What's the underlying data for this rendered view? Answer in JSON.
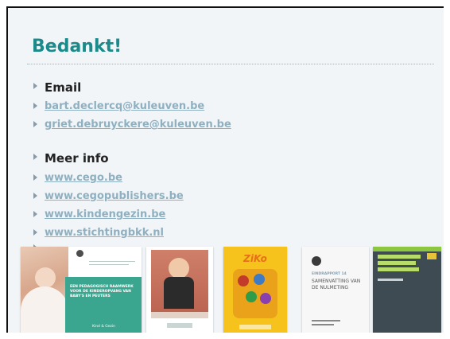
{
  "slide": {
    "title": "Bedankt!",
    "sections": [
      {
        "heading": "Email",
        "links": [
          "bart.declercq@kuleuven.be",
          "griet.debruyckere@kuleuven.be"
        ]
      },
      {
        "heading": "Meer info",
        "links": [
          "www.cego.be",
          "www.cegopublishers.be",
          "www.kindengezin.be",
          "www.stichtingbkk.nl"
        ]
      }
    ]
  },
  "covers": [
    {
      "title": "EEN PEDAGOGISCH RAAMWERK VOOR DE KINDEROPVANG VAN BABY'S EN PEUTERS",
      "publisher": "Kind & Gezin",
      "color": "#3aa68f"
    },
    {
      "title": "ZiKo",
      "color": "#f6c21c"
    },
    {
      "title": "SAMENVATTING VAN DE NULMETING",
      "label": "EINDRAPPORT 14",
      "color": "#f7f7f7"
    },
    {
      "title": "",
      "color": "#3f4b52"
    }
  ],
  "colors": {
    "title": "#1a8a8a",
    "link": "#8fb0c0",
    "background": "#f1f5f8"
  }
}
